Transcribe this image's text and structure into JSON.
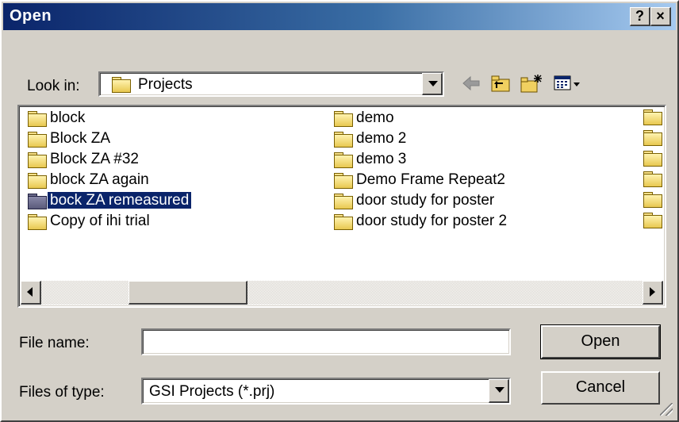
{
  "window": {
    "title": "Open",
    "help_label": "?",
    "close_label": "×"
  },
  "look_in": {
    "label": "Look in:",
    "value": "Projects"
  },
  "toolbar": {
    "icons": [
      "back-arrow-icon",
      "up-one-level-icon",
      "create-new-folder-icon",
      "view-menu-icon"
    ]
  },
  "files": {
    "column1": [
      "block",
      "Block ZA",
      "Block ZA #32",
      "block ZA again",
      "bock ZA remeasured",
      "Copy of ihi trial"
    ],
    "column2": [
      "demo",
      "demo 2",
      "demo 3",
      "Demo Frame Repeat2",
      "door study for poster",
      "door study for poster 2"
    ],
    "selected": "bock ZA remeasured"
  },
  "file_name": {
    "label": "File name:",
    "value": ""
  },
  "file_type": {
    "label": "Files of type:",
    "value": "GSI Projects (*.prj)"
  },
  "buttons": {
    "open": "Open",
    "cancel": "Cancel"
  },
  "colors": {
    "selection": "#0a246a",
    "title_gradient_start": "#0a246a",
    "title_gradient_end": "#a6caf0",
    "face": "#d4d0c8"
  }
}
